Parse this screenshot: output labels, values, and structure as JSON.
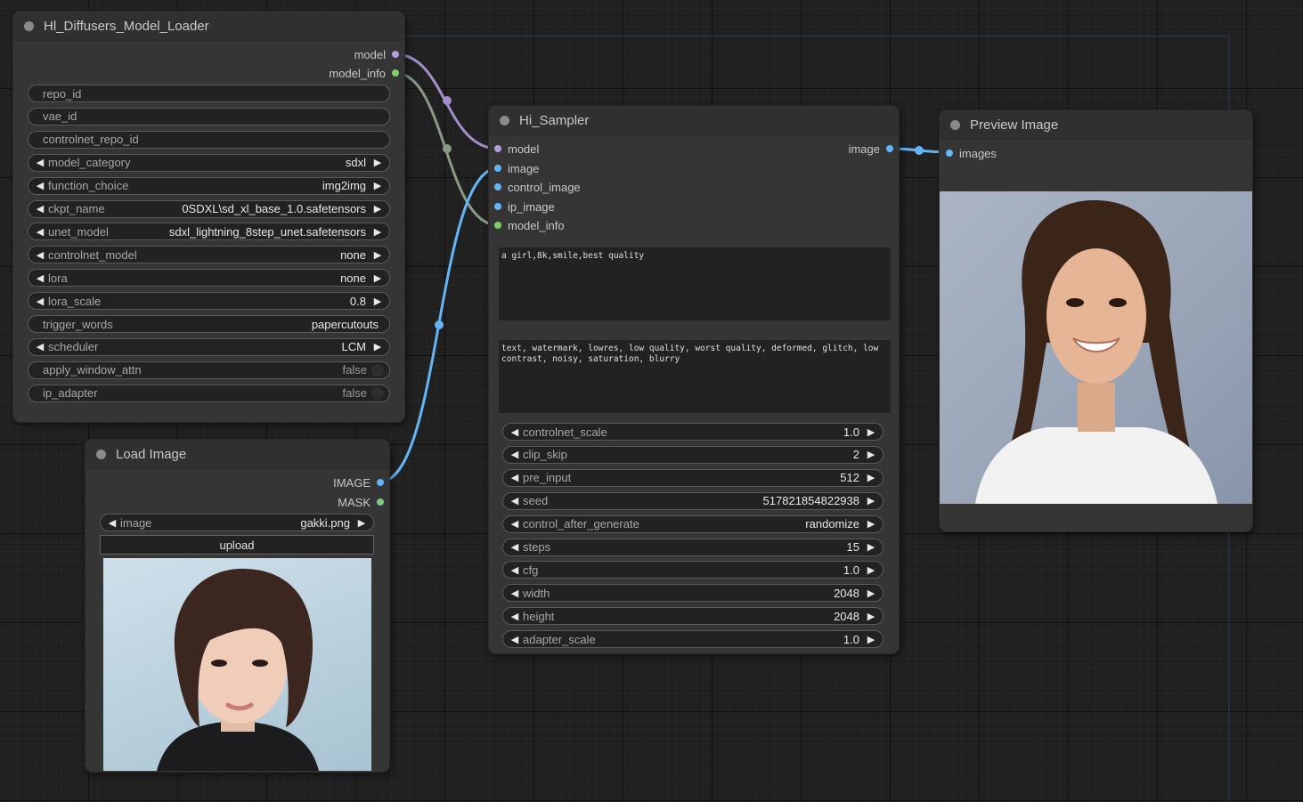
{
  "colors": {
    "model": "#b39ddb",
    "info": "#7ed06b",
    "image": "#64b5f6",
    "mask": "#81c784",
    "link_model": "#a48fc9",
    "link_info": "#8a9a86",
    "link_image": "#64b5f6"
  },
  "loader": {
    "title": "Hl_Diffusers_Model_Loader",
    "outputs": [
      "model",
      "model_info"
    ],
    "widgets": [
      {
        "name": "repo_id",
        "value": "",
        "kind": "text"
      },
      {
        "name": "vae_id",
        "value": "",
        "kind": "text"
      },
      {
        "name": "controlnet_repo_id",
        "value": "",
        "kind": "text"
      },
      {
        "name": "model_category",
        "value": "sdxl",
        "kind": "combo"
      },
      {
        "name": "function_choice",
        "value": "img2img",
        "kind": "combo"
      },
      {
        "name": "ckpt_name",
        "value": "0SDXL\\sd_xl_base_1.0.safetensors",
        "kind": "combo"
      },
      {
        "name": "unet_model",
        "value": "sdxl_lightning_8step_unet.safetensors",
        "kind": "combo"
      },
      {
        "name": "controlnet_model",
        "value": "none",
        "kind": "combo"
      },
      {
        "name": "lora",
        "value": "none",
        "kind": "combo"
      },
      {
        "name": "lora_scale",
        "value": "0.8",
        "kind": "combo"
      },
      {
        "name": "trigger_words",
        "value": "papercutouts",
        "kind": "text"
      },
      {
        "name": "scheduler",
        "value": "LCM",
        "kind": "combo"
      },
      {
        "name": "apply_window_attn",
        "value": "false",
        "kind": "toggle"
      },
      {
        "name": "ip_adapter",
        "value": "false",
        "kind": "toggle"
      }
    ]
  },
  "load_image": {
    "title": "Load Image",
    "outputs": [
      "IMAGE",
      "MASK"
    ],
    "image_label": "image",
    "image_value": "gakki.png",
    "upload_label": "upload"
  },
  "sampler": {
    "title": "Hi_Sampler",
    "inputs": [
      "model",
      "image",
      "control_image",
      "ip_image",
      "model_info"
    ],
    "output": "image",
    "positive_prompt": "a girl,8k,smile,best quality",
    "negative_prompt": "text, watermark, lowres, low quality, worst quality, deformed, glitch, low\ncontrast, noisy, saturation, blurry",
    "widgets": [
      {
        "name": "controlnet_scale",
        "value": "1.0"
      },
      {
        "name": "clip_skip",
        "value": "2"
      },
      {
        "name": "pre_input",
        "value": "512"
      },
      {
        "name": "seed",
        "value": "517821854822938"
      },
      {
        "name": "control_after_generate",
        "value": "randomize"
      },
      {
        "name": "steps",
        "value": "15"
      },
      {
        "name": "cfg",
        "value": "1.0"
      },
      {
        "name": "width",
        "value": "2048"
      },
      {
        "name": "height",
        "value": "2048"
      },
      {
        "name": "adapter_scale",
        "value": "1.0"
      }
    ]
  },
  "preview": {
    "title": "Preview Image",
    "input": "images"
  }
}
